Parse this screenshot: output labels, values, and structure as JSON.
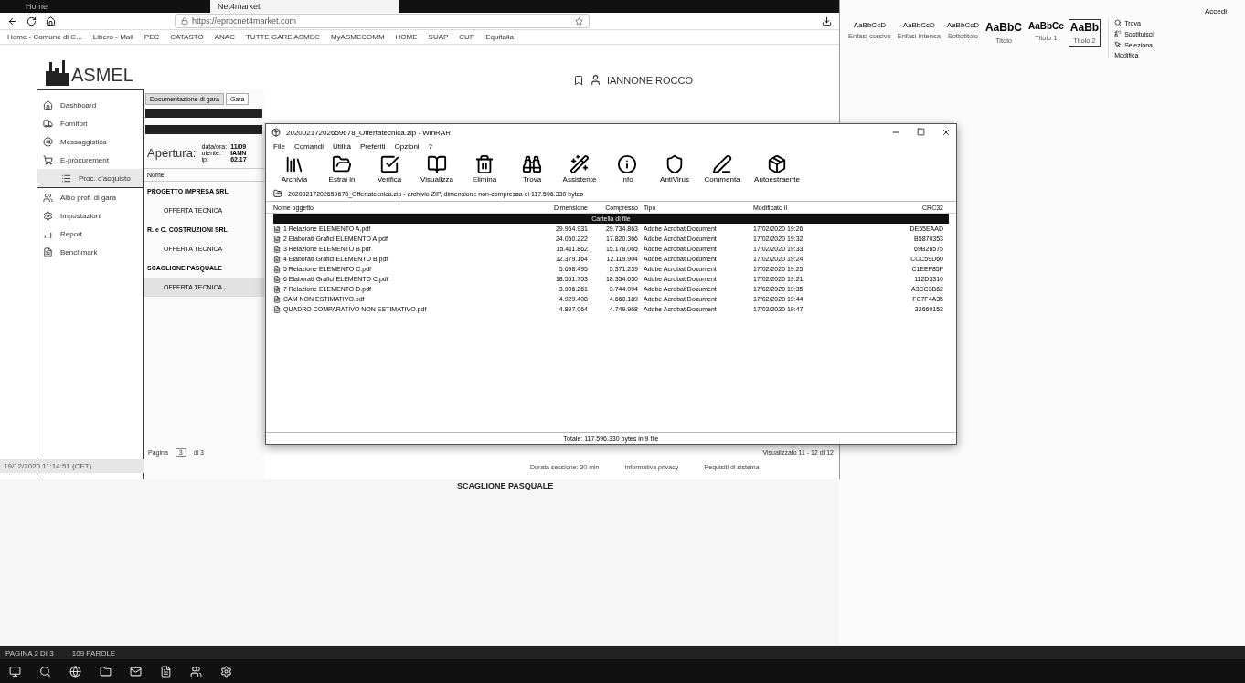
{
  "browser": {
    "tabs": [
      {
        "label": "Home",
        "selected": false
      },
      {
        "label": "Net4market",
        "selected": true
      }
    ],
    "address": "https://eprocnet4market.com",
    "bookmarks": [
      "Home - Comune di C...",
      "Libero - Mail",
      "PEC",
      "CATASTO",
      "ANAC",
      "TUTTE GARE ASMEC",
      "MyASMECOMM",
      "HOME",
      "SUAP",
      "CUP",
      "Equitalia"
    ]
  },
  "app": {
    "logo": "ASMEL",
    "user": "IANNONE ROCCO",
    "menu": [
      {
        "label": "Dashboard",
        "selected": false
      },
      {
        "label": "Fornitori",
        "selected": false
      },
      {
        "label": "Messaggistica",
        "selected": false
      },
      {
        "label": "E-procurement",
        "selected": false
      },
      {
        "label": "Proc. d'acquisto",
        "selected": true
      },
      {
        "label": "Albo prof. di gara",
        "selected": false
      },
      {
        "label": "Impostazioni",
        "selected": false
      },
      {
        "label": "Report",
        "selected": false
      },
      {
        "label": "Benchmark",
        "selected": false
      }
    ],
    "tabs": [
      {
        "label": "Documentazione di gara",
        "selected": false
      },
      {
        "label": "Gara",
        "selected": true
      }
    ],
    "opening": {
      "title": "Apertura:",
      "fields": [
        {
          "label": "data/ora:",
          "value": "11/09"
        },
        {
          "label": "utente:",
          "value": "IANN"
        },
        {
          "label": "ip:",
          "value": "62.17"
        }
      ]
    },
    "tree_header": "Nome",
    "tree": [
      {
        "label": "PROGETTO IMPRESA SRL",
        "selected": false,
        "children": [
          {
            "label": "OFFERTA TECNICA",
            "selected": false
          }
        ]
      },
      {
        "label": "R. e C. COSTRUZIONI SRL",
        "selected": false,
        "children": [
          {
            "label": "OFFERTA TECNICA",
            "selected": false
          }
        ]
      },
      {
        "label": "SCAGLIONE PASQUALE",
        "selected": false,
        "children": [
          {
            "label": "OFFERTA TECNICA",
            "selected": true
          }
        ]
      }
    ],
    "pager": {
      "label": "Pagina",
      "value": "3",
      "total": "di 3",
      "shown": "Visualizzato 11 - 12 di 12"
    },
    "timestamp": "19/12/2020 11:14:51 (CET)",
    "footer": [
      "Durata sessione: 30 min",
      "Informativa privacy",
      "Requisiti di sistema"
    ],
    "bottom_name": "SCAGLIONE PASQUALE"
  },
  "winrar": {
    "title": "20200217202659678_Offertatecnica.zip - WinRAR",
    "menu": [
      "File",
      "Comandi",
      "Utilità",
      "Preferiti",
      "Opzioni",
      "?"
    ],
    "tools": [
      "Archivia",
      "Estrai in",
      "Verifica",
      "Visualizza",
      "Elimina",
      "Trova",
      "Assistente",
      "Info",
      "AntiVirus",
      "Commenta",
      "Autoestraente"
    ],
    "path": "20200217202659678_Offertatecnica.zip - archivio ZIP, dimensione non-compressa di 117.596.330 bytes",
    "columns": [
      "Nome oggetto",
      "Dimensione",
      "Compresso",
      "Tipo",
      "Modificato il",
      "CRC32"
    ],
    "folder_row": "Cartella di file",
    "rows": [
      [
        "1 Relazione ELEMENTO A.pdf",
        "29.964.931",
        "29.734.863",
        "Adobe Acrobat Document",
        "17/02/2020 19:26",
        "DE55EAAD"
      ],
      [
        "2 Elaborati Grafici ELEMENTO A.pdf",
        "24.050.222",
        "17.820.366",
        "Adobe Acrobat Document",
        "17/02/2020 19:32",
        "B5870353"
      ],
      [
        "3 Relazione ELEMENTO B.pdf",
        "15.411.862",
        "15.178.065",
        "Adobe Acrobat Document",
        "17/02/2020 19:33",
        "69B26575"
      ],
      [
        "4 Elaborati Grafici ELEMENTO B.pdf",
        "12.379.164",
        "12.119.904",
        "Adobe Acrobat Document",
        "17/02/2020 19:24",
        "CCC59D60"
      ],
      [
        "5 Relazione ELEMENTO C.pdf",
        "5.698.495",
        "5.371.239",
        "Adobe Acrobat Document",
        "17/02/2020 19:25",
        "C1EEF85F"
      ],
      [
        "6 Elaborati Grafici ELEMENTO C.pdf",
        "18.551.753",
        "18.354.630",
        "Adobe Acrobat Document",
        "17/02/2020 19:21",
        "112D3310"
      ],
      [
        "7 Relazione ELEMENTO D.pdf",
        "3.906.261",
        "3.744.094",
        "Adobe Acrobat Document",
        "17/02/2020 19:35",
        "A3CC3B62"
      ],
      [
        "CAM NON ESTIMATIVO.pdf",
        "4.929.408",
        "4.660.189",
        "Adobe Acrobat Document",
        "17/02/2020 19:44",
        "FC7F4A35"
      ],
      [
        "QUADRO COMPARATIVO NON ESTIMATIVO.pdf",
        "4.897.064",
        "4.749.968",
        "Adobe Acrobat Document",
        "17/02/2020 19:47",
        "32660153"
      ]
    ],
    "status": "Totale: 117.596.330 bytes in 9 file"
  },
  "word": {
    "account": "Accedi",
    "styles": [
      {
        "sample": "AaBbCcD",
        "name": "Enfasi corsivo",
        "selected": false
      },
      {
        "sample": "AaBbCcD",
        "name": "Enfasi intensa",
        "selected": false
      },
      {
        "sample": "AaBbCcD",
        "name": "Sottotitolo",
        "selected": false
      },
      {
        "sample": "AaBbC",
        "name": "Titolo",
        "selected": false
      },
      {
        "sample": "AaBbCc",
        "name": "Titolo 1",
        "selected": false
      },
      {
        "sample": "AaBb",
        "name": "Titolo 2",
        "selected": true
      }
    ],
    "edit": [
      "Trova",
      "Sostituisci",
      "Seleziona"
    ],
    "edit_group": "Modifica",
    "status": [
      "PAGINA 2 DI 3",
      "109 PAROLE"
    ]
  }
}
